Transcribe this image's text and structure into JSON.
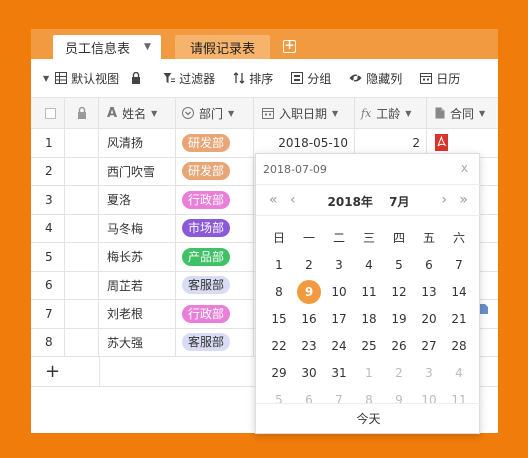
{
  "tabs": [
    {
      "label": "员工信息表",
      "active": true
    },
    {
      "label": "请假记录表",
      "active": false
    }
  ],
  "toolbar": {
    "view": "默认视图",
    "filter": "过滤器",
    "sort": "排序",
    "group": "分组",
    "hide": "隐藏列",
    "calendar": "日历"
  },
  "columns": [
    "姓名",
    "部门",
    "入职日期",
    "工龄",
    "合同"
  ],
  "rows": [
    {
      "num": "1",
      "name": "风清扬",
      "dept": "研发部",
      "dept_color": "#e8a676",
      "date": "2018-05-10",
      "years": "2"
    },
    {
      "num": "2",
      "name": "西门吹雪",
      "dept": "研发部",
      "dept_color": "#e8a676"
    },
    {
      "num": "3",
      "name": "夏洛",
      "dept": "行政部",
      "dept_color": "#e97fd9"
    },
    {
      "num": "4",
      "name": "马冬梅",
      "dept": "市场部",
      "dept_color": "#8b5ad9"
    },
    {
      "num": "5",
      "name": "梅长苏",
      "dept": "产品部",
      "dept_color": "#3ec265"
    },
    {
      "num": "6",
      "name": "周芷若",
      "dept": "客服部",
      "dept_color": "#d9dcf5",
      "dept_text_color": "#333"
    },
    {
      "num": "7",
      "name": "刘老根",
      "dept": "行政部",
      "dept_color": "#e97fd9"
    },
    {
      "num": "8",
      "name": "苏大强",
      "dept": "客服部",
      "dept_color": "#d9dcf5",
      "dept_text_color": "#333"
    }
  ],
  "add_row": "+",
  "datepicker": {
    "input_value": "2018-07-09",
    "close": "x",
    "year_label": "2018年",
    "month_label": "7月",
    "nav": {
      "prev_year": "«",
      "prev_month": "‹",
      "next_month": "›",
      "next_year": "»"
    },
    "weekdays": [
      "日",
      "一",
      "二",
      "三",
      "四",
      "五",
      "六"
    ],
    "weeks": [
      [
        {
          "d": "1"
        },
        {
          "d": "2"
        },
        {
          "d": "3"
        },
        {
          "d": "4"
        },
        {
          "d": "5"
        },
        {
          "d": "6"
        },
        {
          "d": "7"
        }
      ],
      [
        {
          "d": "8"
        },
        {
          "d": "9",
          "selected": true
        },
        {
          "d": "10"
        },
        {
          "d": "11"
        },
        {
          "d": "12"
        },
        {
          "d": "13"
        },
        {
          "d": "14"
        }
      ],
      [
        {
          "d": "15"
        },
        {
          "d": "16"
        },
        {
          "d": "17"
        },
        {
          "d": "18"
        },
        {
          "d": "19"
        },
        {
          "d": "20"
        },
        {
          "d": "21"
        }
      ],
      [
        {
          "d": "22"
        },
        {
          "d": "23"
        },
        {
          "d": "24"
        },
        {
          "d": "25"
        },
        {
          "d": "26"
        },
        {
          "d": "27"
        },
        {
          "d": "28"
        }
      ],
      [
        {
          "d": "29"
        },
        {
          "d": "30"
        },
        {
          "d": "31"
        },
        {
          "d": "1",
          "muted": true
        },
        {
          "d": "2",
          "muted": true
        },
        {
          "d": "3",
          "muted": true
        },
        {
          "d": "4",
          "muted": true
        }
      ],
      [
        {
          "d": "5",
          "muted": true
        },
        {
          "d": "6",
          "muted": true
        },
        {
          "d": "7",
          "muted": true
        },
        {
          "d": "8",
          "muted": true
        },
        {
          "d": "9",
          "muted": true
        },
        {
          "d": "10",
          "muted": true
        },
        {
          "d": "11",
          "muted": true
        }
      ]
    ],
    "today": "今天"
  },
  "colors": {
    "accent": "#f19a3f",
    "background": "#f07c0c",
    "pdf_red": "#d9342b"
  }
}
